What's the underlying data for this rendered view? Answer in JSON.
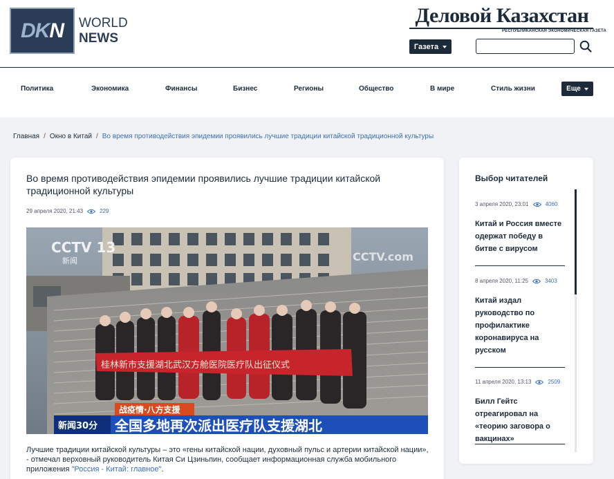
{
  "header": {
    "logo_mark_prefix": "DK",
    "logo_mark_suffix": "N",
    "logo_line1": "WORLD",
    "logo_line2": "NEWS",
    "paper_title": "Деловой Казахстан",
    "paper_subtitle": "РЕСПУБЛИКАНСКАЯ ЭКОНОМИЧЕСКАЯ ГАЗЕТА",
    "gazeta_label": "Газета",
    "search_value": ""
  },
  "nav": {
    "items": [
      "Политика",
      "Экономика",
      "Финансы",
      "Бизнес",
      "Регионы",
      "Общество",
      "В мире",
      "Стиль жизни"
    ],
    "more_label": "Еще"
  },
  "breadcrumb": {
    "home": "Главная",
    "sep": "/",
    "section": "Окно в Китай",
    "current": "Во время противодействия эпидемии проявились лучшие традиции китайской традиционной культуры"
  },
  "article": {
    "title": "Во время противодействия эпидемии проявились лучшие традиции китайской традиционной культуры",
    "date": "29 апреля 2020, 21:43",
    "views": "229",
    "image": {
      "logo": "CCTV 13",
      "logo_sub": "新闻",
      "watermark": "CCTV.com",
      "banner_text": "桂林新市支援湖北武汉方舱医院医疗队出征仪式",
      "caption_tag": "战疫情·八方支援",
      "caption_show": "新闻30分",
      "caption_main": "全国多地再次派出医疗队支援湖北"
    },
    "body_text": "Лучшие традиции китайской культуры – это «гены китайской нации, духовный пульс и артерии китайской нации», - отмечал верховный руководитель Китая Си Цзиньпин, сообщает информационная служба мобильного приложения ",
    "body_link": "\"Россия - Китай: главное\"",
    "body_end": "."
  },
  "sidebar": {
    "title": "Выбор читателей",
    "items": [
      {
        "date": "3 апреля 2020, 23:01",
        "views": "4060",
        "headline": "Китай и Россия вместе одержат победу в битве с вирусом"
      },
      {
        "date": "8 апреля 2020, 11:25",
        "views": "3403",
        "headline": "Китай издал руководство по профилактике коронавируса на русском"
      },
      {
        "date": "11 апреля 2020, 13:13",
        "views": "2509",
        "headline": "Билл Гейтс отреагировал на «теорию заговора о вакцинах»"
      }
    ]
  },
  "colors": {
    "navy": "#1c2a3a",
    "link": "#3b6fb6",
    "background": "#f0f2f5"
  }
}
